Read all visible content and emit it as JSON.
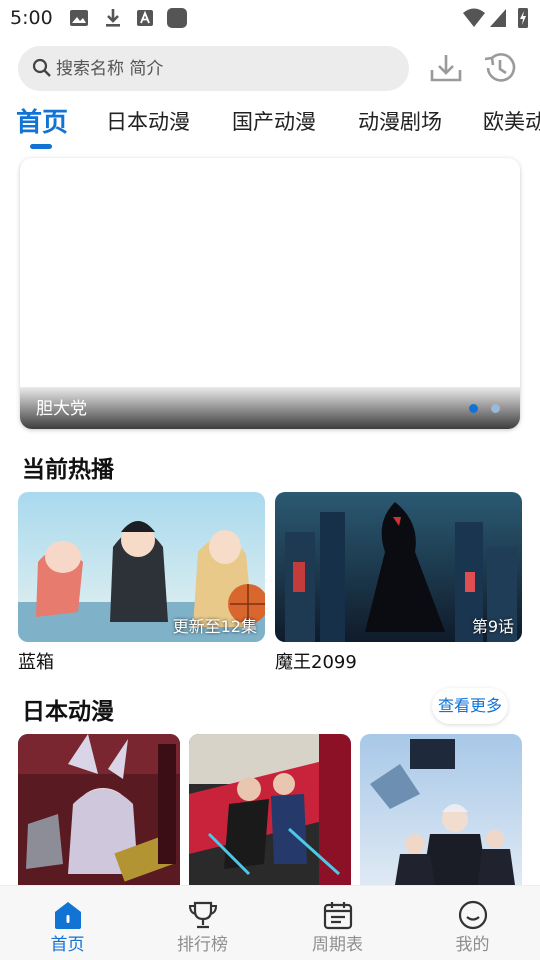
{
  "status_bar": {
    "time": "5:00"
  },
  "search": {
    "placeholder": "搜索名称 简介"
  },
  "tabs": [
    {
      "label": "首页",
      "active": true
    },
    {
      "label": "日本动漫",
      "active": false
    },
    {
      "label": "国产动漫",
      "active": false
    },
    {
      "label": "动漫剧场",
      "active": false
    },
    {
      "label": "欧美动",
      "active": false
    }
  ],
  "banner": {
    "title": "胆大党",
    "page_count": 2,
    "current_page": 1
  },
  "now_airing": {
    "title": "当前热播",
    "items": [
      {
        "name": "蓝箱",
        "episode": "更新至12集"
      },
      {
        "name": "魔王2099",
        "episode": "第9话"
      }
    ]
  },
  "japanese_anime": {
    "title": "日本动漫",
    "more_label": "查看更多"
  },
  "bottom_nav": [
    {
      "label": "首页",
      "icon": "home-icon",
      "active": true
    },
    {
      "label": "排行榜",
      "icon": "trophy-icon",
      "active": false
    },
    {
      "label": "周期表",
      "icon": "calendar-icon",
      "active": false
    },
    {
      "label": "我的",
      "icon": "smile-icon",
      "active": false
    }
  ],
  "colors": {
    "accent": "#1173d4",
    "inactive": "#8f8f8f"
  }
}
